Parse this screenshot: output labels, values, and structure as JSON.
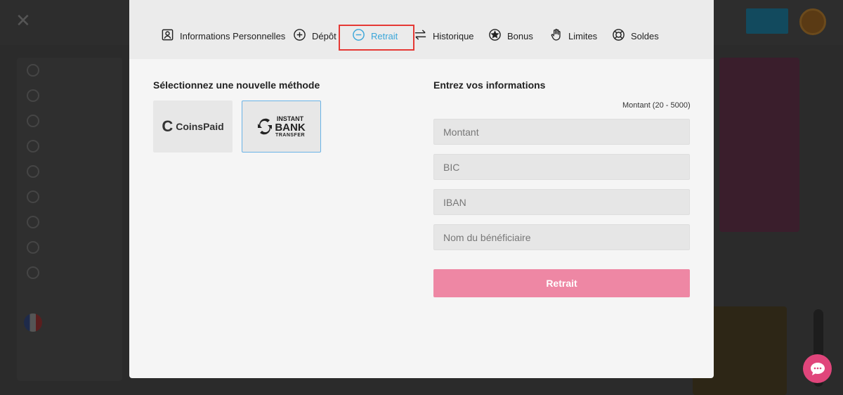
{
  "modal": {
    "tabs": [
      {
        "label": "Informations Personnelles",
        "icon": "user-card-icon"
      },
      {
        "label": "Dépôt",
        "icon": "plus-circle-icon"
      },
      {
        "label": "Retrait",
        "icon": "minus-circle-icon",
        "active": true
      },
      {
        "label": "Historique",
        "icon": "swap-arrows-icon"
      },
      {
        "label": "Bonus",
        "icon": "star-circle-icon"
      },
      {
        "label": "Limites",
        "icon": "hand-icon"
      },
      {
        "label": "Soldes",
        "icon": "lifebuoy-icon"
      }
    ],
    "left": {
      "title": "Sélectionnez une nouvelle méthode",
      "methods": [
        {
          "name": "CoinsPaid",
          "logo_text": "CoinsPaid",
          "selected": false
        },
        {
          "name": "Instant Bank Transfer",
          "logo_lines": [
            "INSTANT",
            "BANK",
            "TRANSFER"
          ],
          "selected": true
        }
      ]
    },
    "right": {
      "title": "Entrez vos informations",
      "amount_hint": "Montant (20 - 5000)",
      "fields": {
        "amount": {
          "placeholder": "Montant",
          "value": ""
        },
        "bic": {
          "placeholder": "BIC",
          "value": ""
        },
        "iban": {
          "placeholder": "IBAN",
          "value": ""
        },
        "beneficiary": {
          "placeholder": "Nom du bénéficiaire",
          "value": ""
        }
      },
      "submit_label": "Retrait"
    }
  },
  "colors": {
    "accent": "#3aa6d9",
    "submit": "#ee87a4",
    "highlight": "#e53935",
    "chat": "#e0457b"
  },
  "chat": {
    "icon": "chat-bubble-icon"
  }
}
